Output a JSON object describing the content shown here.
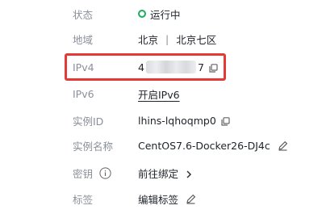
{
  "status": {
    "label": "状态",
    "value": "运行中",
    "color": "#1aad5a"
  },
  "region": {
    "label": "地域",
    "city": "北京",
    "separator": "|",
    "zone": "北京七区"
  },
  "ipv4": {
    "label": "IPv4",
    "prefix": "4",
    "suffix": "7",
    "highlight_color": "#e53935"
  },
  "ipv6": {
    "label": "IPv6",
    "action": "开启IPv6"
  },
  "instance_id": {
    "label": "实例ID",
    "value": "lhins-lqhoqmp0"
  },
  "instance_name": {
    "label": "实例名称",
    "value": "CentOS7.6-Docker26-DJ4c"
  },
  "key": {
    "label": "密钥",
    "action": "前往绑定"
  },
  "tags": {
    "label": "标签",
    "action": "编辑标签"
  },
  "icons": {
    "status": "running-circle-icon",
    "copy": "copy-icon",
    "edit": "pencil-icon",
    "info": "info-icon",
    "chevron": "chevron-right-icon"
  }
}
